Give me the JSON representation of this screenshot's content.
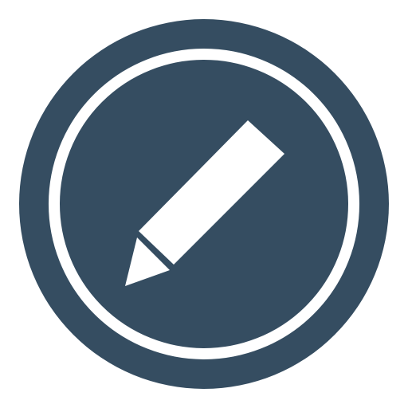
{
  "icon": {
    "name": "edit-pencil-icon",
    "colors": {
      "background": "#ffffff",
      "circle": "#354d61",
      "ring": "#ffffff",
      "pencil": "#ffffff"
    }
  }
}
